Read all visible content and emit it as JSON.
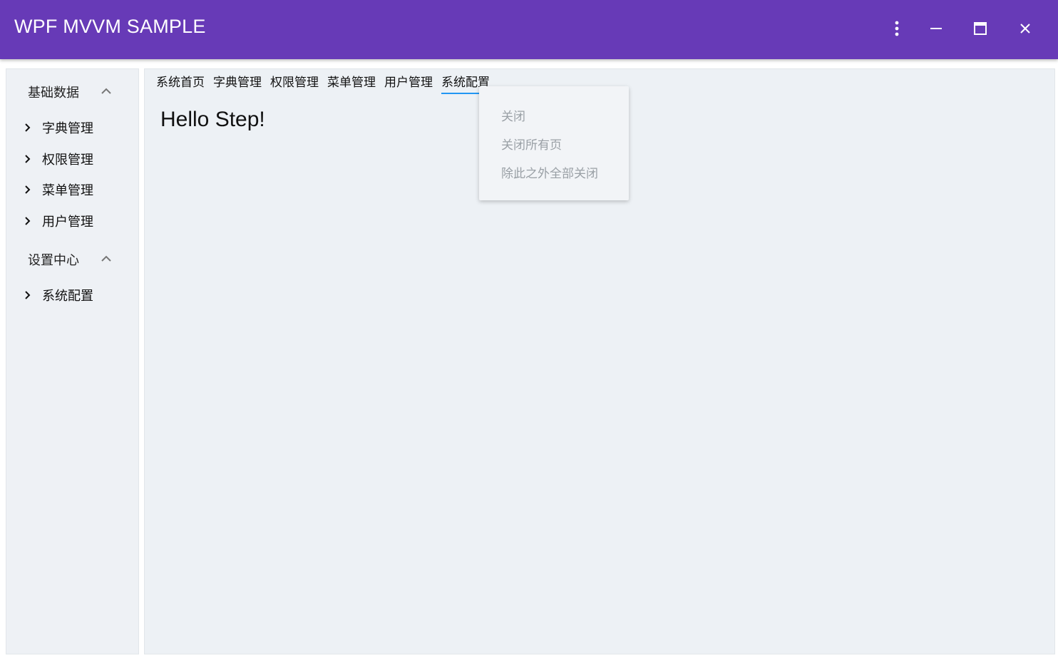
{
  "window": {
    "title": "WPF MVVM SAMPLE",
    "buttons": {
      "more": "more-vert-icon",
      "minimize": "minimize-icon",
      "maximize": "maximize-icon",
      "close": "close-icon"
    },
    "accent": "#673ab7"
  },
  "sidebar": {
    "groups": [
      {
        "label": "基础数据",
        "expanded": true,
        "items": [
          {
            "label": "字典管理"
          },
          {
            "label": "权限管理"
          },
          {
            "label": "菜单管理"
          },
          {
            "label": "用户管理"
          }
        ]
      },
      {
        "label": "设置中心",
        "expanded": true,
        "items": [
          {
            "label": "系统配置"
          }
        ]
      }
    ]
  },
  "main": {
    "tabs": [
      {
        "label": "系统首页",
        "active": false
      },
      {
        "label": "字典管理",
        "active": false
      },
      {
        "label": "权限管理",
        "active": false
      },
      {
        "label": "菜单管理",
        "active": false
      },
      {
        "label": "用户管理",
        "active": false
      },
      {
        "label": "系统配置",
        "active": true
      }
    ],
    "content_text": "Hello Step!",
    "active_tab_color": "#2196f3"
  },
  "context_menu": {
    "items": [
      {
        "label": "关闭"
      },
      {
        "label": "关闭所有页"
      },
      {
        "label": "除此之外全部关闭"
      }
    ]
  }
}
